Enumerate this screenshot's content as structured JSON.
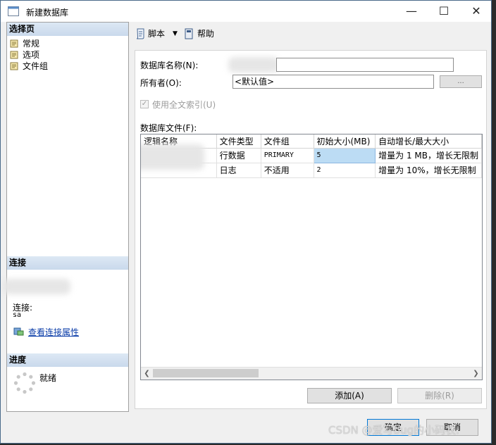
{
  "window": {
    "title": "新建数据库",
    "controls": [
      "—",
      "☐",
      "✕"
    ]
  },
  "left": {
    "select_page_header": "选择页",
    "pages": [
      "常规",
      "选项",
      "文件组"
    ],
    "connection_header": "连接",
    "connection_label": "连接:",
    "connection_user": "sa",
    "view_connection_link": "查看连接属性",
    "progress_header": "进度",
    "progress_status": "就绪"
  },
  "toolbar": {
    "script_label": "脚本",
    "help_label": "帮助"
  },
  "form": {
    "db_name_label": "数据库名称(N):",
    "db_name_value": "",
    "owner_label": "所有者(O):",
    "owner_value": "<默认值>",
    "owner_browse": "...",
    "fulltext_label": "使用全文索引(U)",
    "files_label": "数据库文件(F):",
    "columns": [
      "逻辑名称",
      "文件类型",
      "文件组",
      "初始大小(MB)",
      "自动增长/最大大小"
    ],
    "rows": [
      {
        "logical_name": "",
        "file_type": "行数据",
        "filegroup": "PRIMARY",
        "initial_size": "5",
        "autogrowth": "增量为 1 MB，增长无限制"
      },
      {
        "logical_name": "",
        "file_type": "日志",
        "filegroup": "不适用",
        "initial_size": "2",
        "autogrowth": "增量为 10%，增长无限制"
      }
    ],
    "add_button": "添加(A)",
    "remove_button": "删除(R)"
  },
  "footer": {
    "ok_button": "确定",
    "cancel_button": "取消"
  },
  "watermark": "CSDN @爱写bug的小码农."
}
